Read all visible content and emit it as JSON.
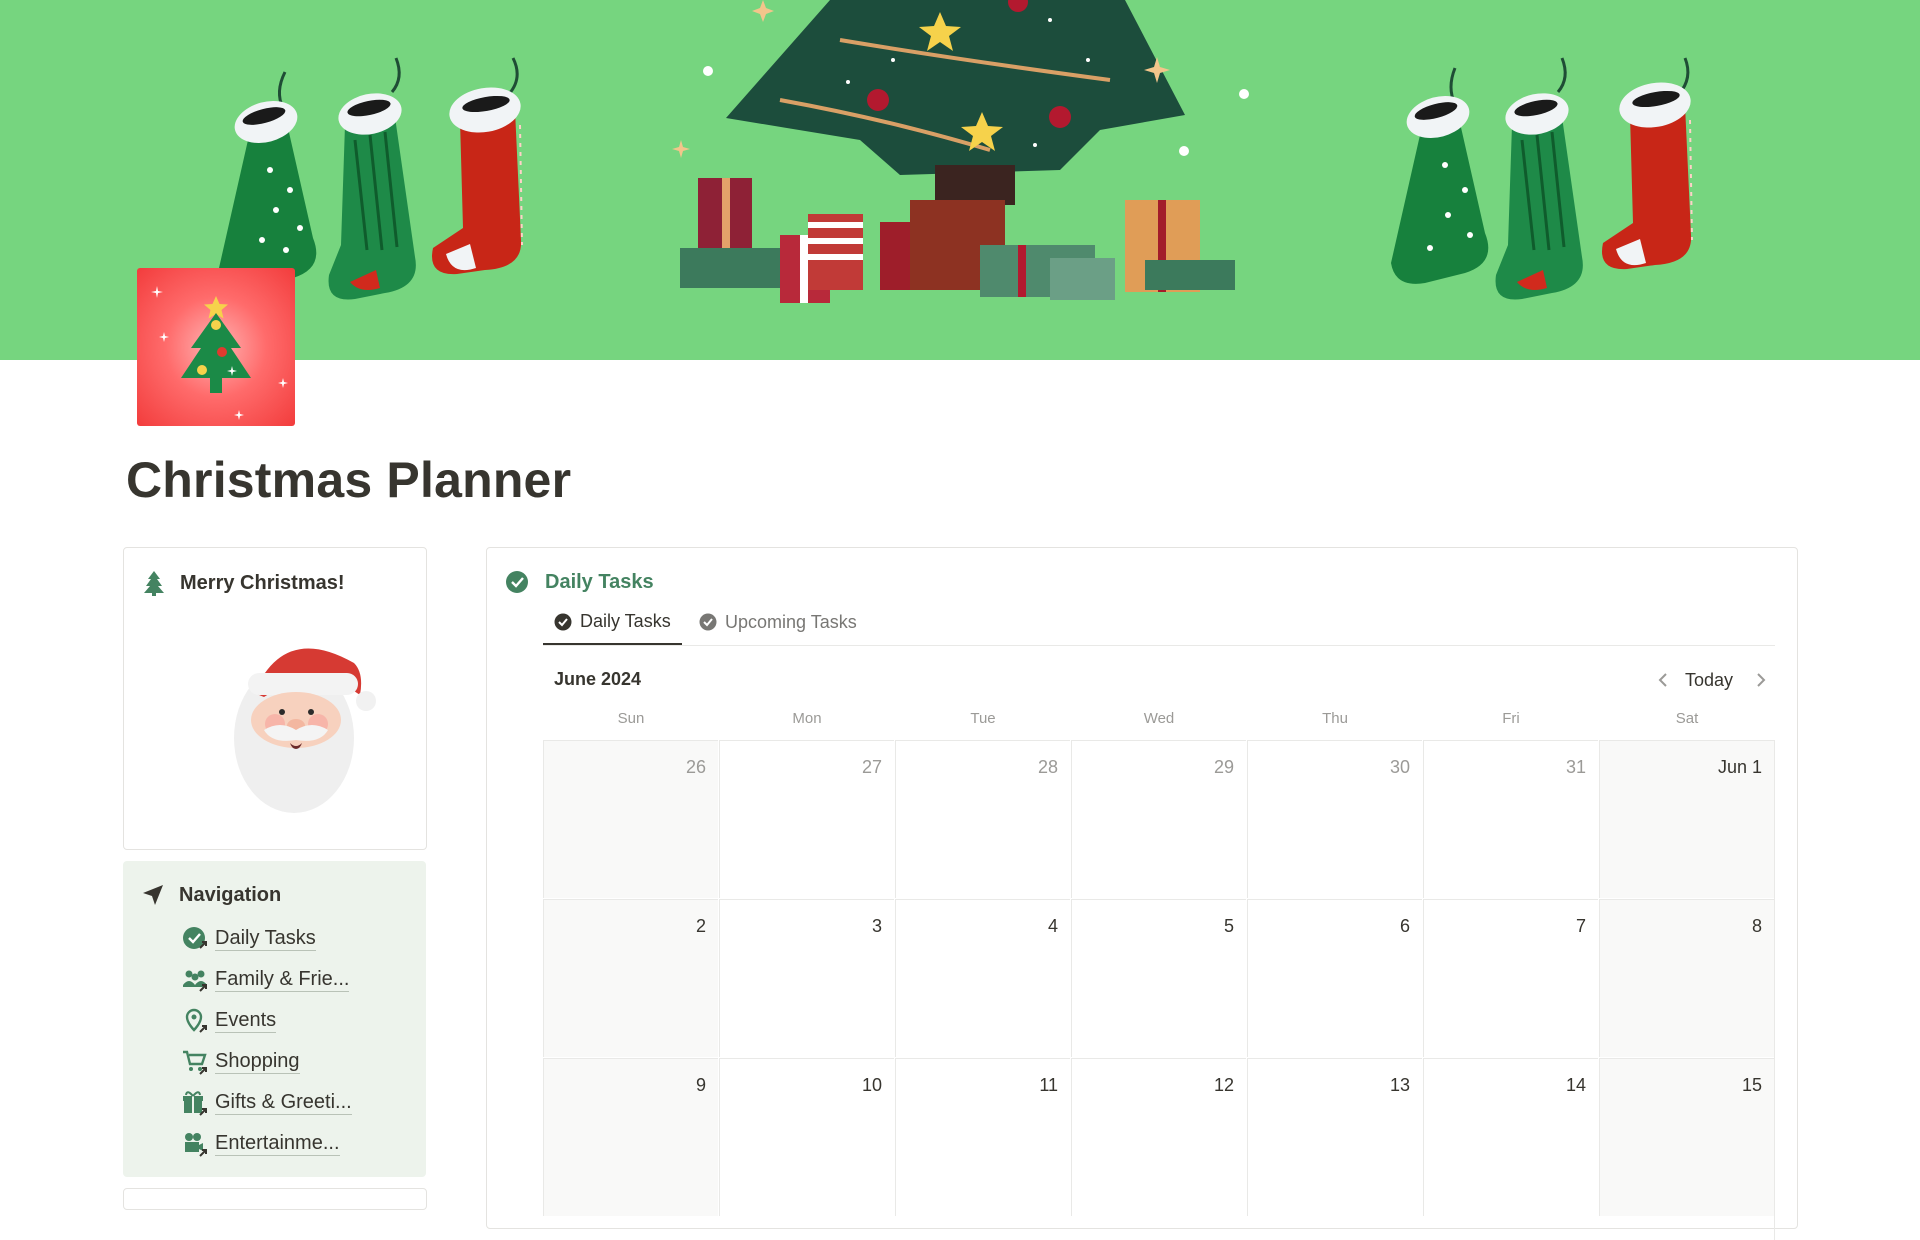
{
  "page": {
    "title": "Christmas Planner",
    "cover_color": "#76d57f",
    "icon": "christmas-tree-icon"
  },
  "merry_card": {
    "title": "Merry Christmas!",
    "icon": "christmas-tree-icon",
    "image": "santa-illustration"
  },
  "navigation": {
    "title": "Navigation",
    "icon": "location-arrow-icon",
    "items": [
      {
        "label": "Daily Tasks",
        "icon": "check-circle-link-icon"
      },
      {
        "label": "Family & Frie...",
        "icon": "people-link-icon"
      },
      {
        "label": "Events",
        "icon": "map-pin-link-icon"
      },
      {
        "label": "Shopping",
        "icon": "cart-link-icon"
      },
      {
        "label": "Gifts & Greeti...",
        "icon": "gift-link-icon"
      },
      {
        "label": "Entertainme...",
        "icon": "film-camera-link-icon"
      }
    ]
  },
  "tasks": {
    "title": "Daily Tasks",
    "accent_color": "#448361",
    "tabs": [
      {
        "label": "Daily Tasks",
        "active": true
      },
      {
        "label": "Upcoming Tasks",
        "active": false
      }
    ],
    "calendar": {
      "month_label": "June 2024",
      "today_label": "Today",
      "weekdays": [
        "Sun",
        "Mon",
        "Tue",
        "Wed",
        "Thu",
        "Fri",
        "Sat"
      ],
      "weeks": [
        [
          "26",
          "27",
          "28",
          "29",
          "30",
          "31",
          "Jun 1"
        ],
        [
          "2",
          "3",
          "4",
          "5",
          "6",
          "7",
          "8"
        ],
        [
          "9",
          "10",
          "11",
          "12",
          "13",
          "14",
          "15"
        ]
      ]
    }
  }
}
